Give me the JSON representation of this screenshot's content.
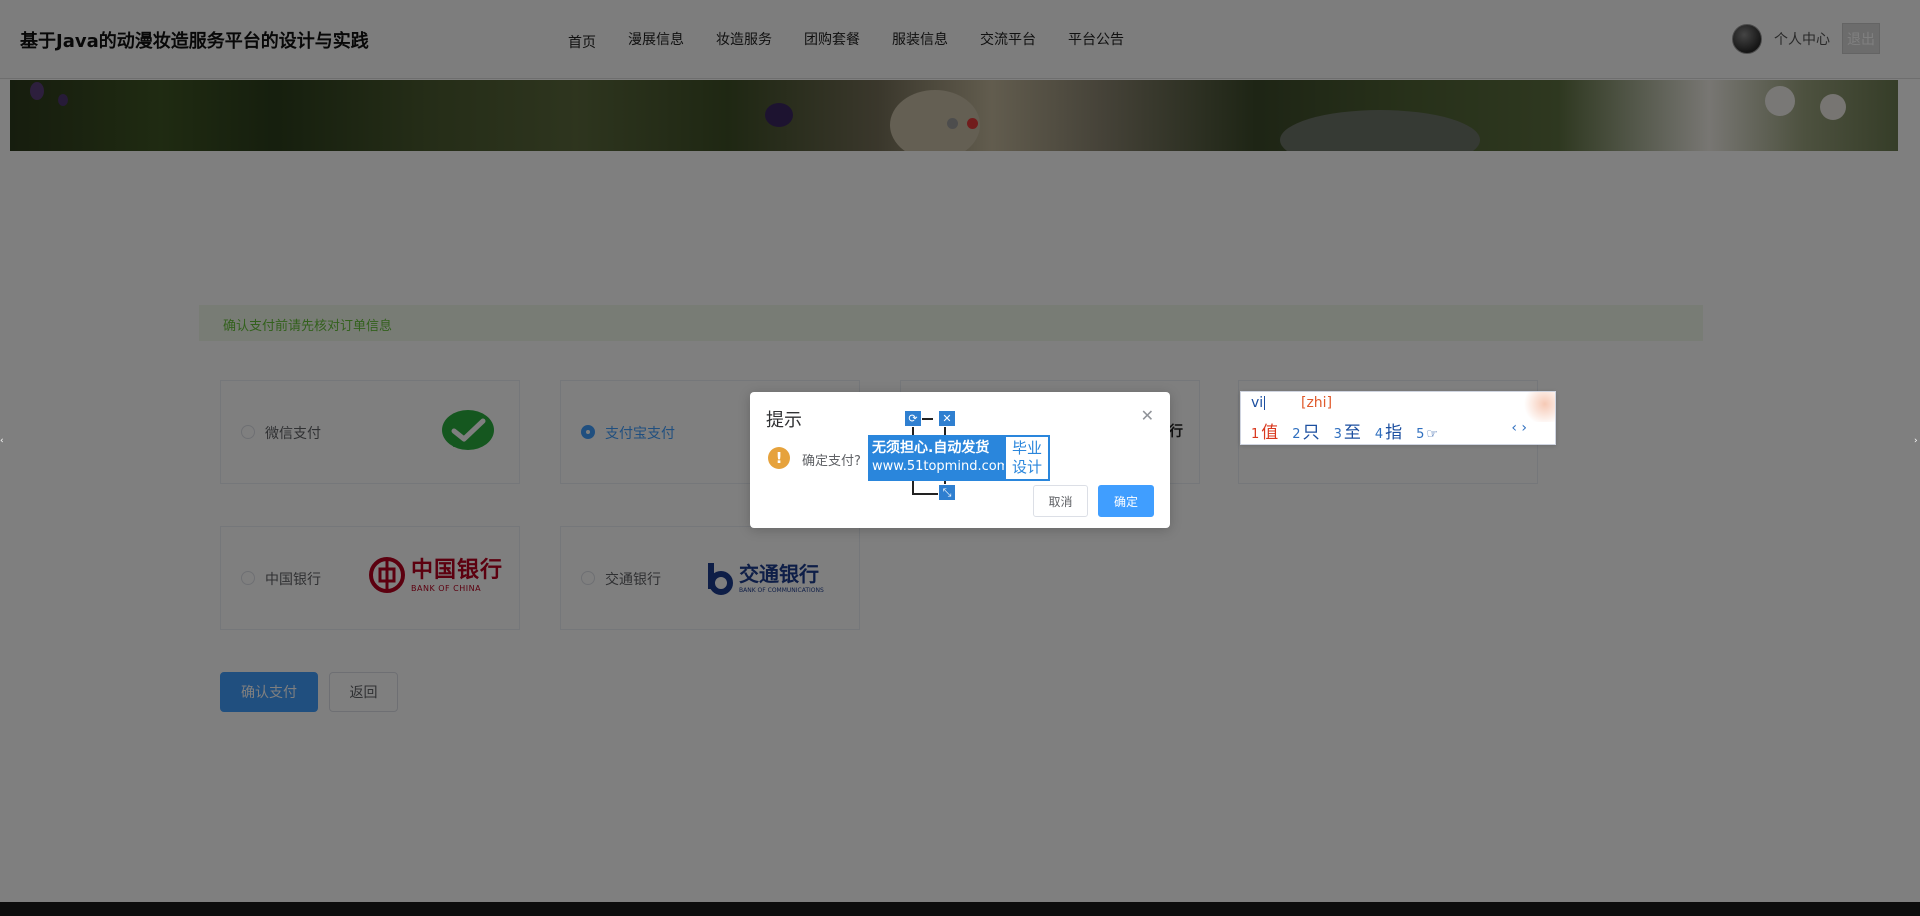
{
  "header": {
    "site_title": "基于Java的动漫妆造服务平台的设计与实践",
    "nav": [
      "首页",
      "漫展信息",
      "妆造服务",
      "团购套餐",
      "服装信息",
      "交流平台",
      "平台公告"
    ],
    "user_center": "个人中心",
    "logout": "退出"
  },
  "page": {
    "tip": "确认支付前请先核对订单信息",
    "payment_methods": [
      {
        "label": "微信支付",
        "selected": false
      },
      {
        "label": "支付宝支付",
        "selected": true
      },
      {
        "label": "中国银行",
        "selected": false
      },
      {
        "label": "交通银行",
        "selected": false
      }
    ],
    "boc_logo_cn": "中国银行",
    "boc_logo_en": "BANK OF CHINA",
    "bocom_logo_cn": "交通银行",
    "bocom_logo_en": "BANK OF COMMUNICATIONS",
    "partial_text": "行",
    "confirm_button": "确认支付",
    "back_button": "返回"
  },
  "dialog": {
    "title": "提示",
    "message": "确定支付?",
    "cancel": "取消",
    "ok": "确定"
  },
  "watermark": {
    "line1": "无须担心.自动发货",
    "line2": "www.51topmind.com",
    "side1": "毕业",
    "side2": "设计"
  },
  "ime": {
    "input": "vi",
    "pinyin": "[zhi]",
    "candidates": [
      {
        "num": "1",
        "char": "值"
      },
      {
        "num": "2",
        "char": "只"
      },
      {
        "num": "3",
        "char": "至"
      },
      {
        "num": "4",
        "char": "指"
      },
      {
        "num": "5",
        "char": "☞"
      }
    ],
    "nav": "‹ ›"
  },
  "colors": {
    "primary": "#409eff",
    "success_text": "#67c23a",
    "success_bg": "#f0f9eb",
    "warning": "#e6a23c",
    "overlay": "rgba(0,0,0,0.5)"
  }
}
